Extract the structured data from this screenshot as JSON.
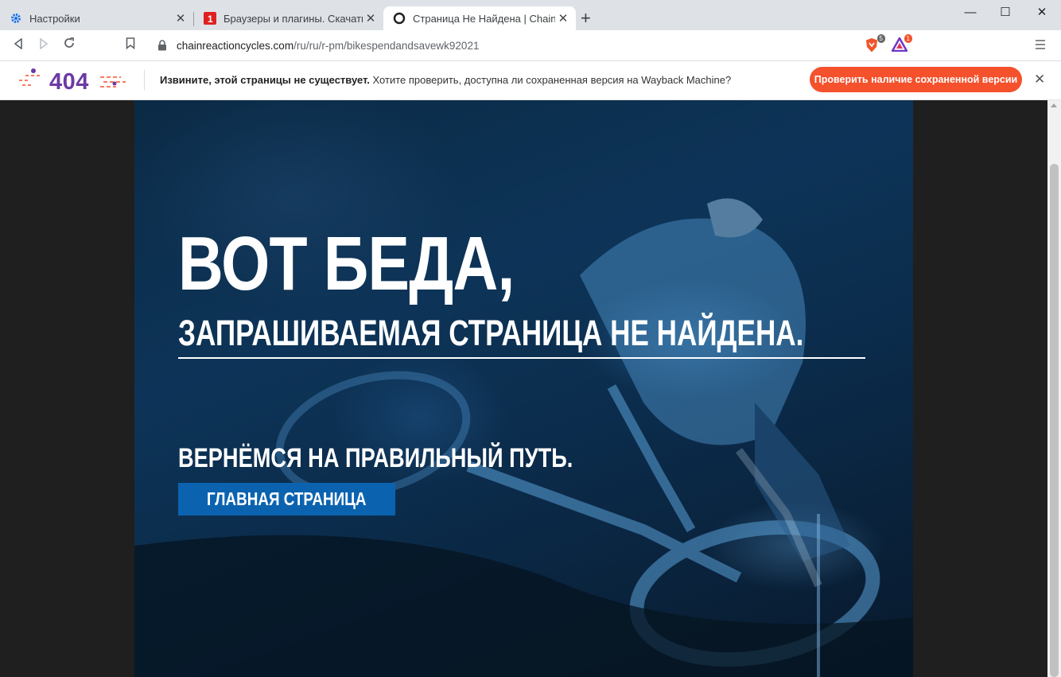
{
  "tabs": [
    {
      "title": "Настройки",
      "icon": "gear-icon"
    },
    {
      "title": "Браузеры и плагины. Скачать бе",
      "icon": "site-red-icon"
    },
    {
      "title": "Страница Не Найдена | Chain Rea",
      "icon": "site-globe-icon"
    }
  ],
  "address": {
    "host": "chainreactioncycles.com",
    "path": "/ru/ru/r-pm/bikespendandsavewk92021"
  },
  "extensions": {
    "brave_badge": "5",
    "rewards_badge": "1"
  },
  "infobar": {
    "logo": "404",
    "bold_text": "Извините, этой страницы не существует.",
    "text": " Хотите проверить, доступна ли сохраненная версия на Wayback Machine?",
    "button": "Проверить наличие сохраненной версии"
  },
  "page": {
    "heading": "ВОТ БЕДА,",
    "subheading": "ЗАПРАШИВАЕМАЯ СТРАНИЦА НЕ НАЙДЕНА.",
    "cta_text": "ВЕРНЁМСЯ НА ПРАВИЛЬНЫЙ ПУТЬ.",
    "home_button": "ГЛАВНАЯ СТРАНИЦА"
  },
  "colors": {
    "accent": "#f4512c",
    "button_blue": "#0b63b0",
    "logo_purple": "#6c3aa5"
  }
}
